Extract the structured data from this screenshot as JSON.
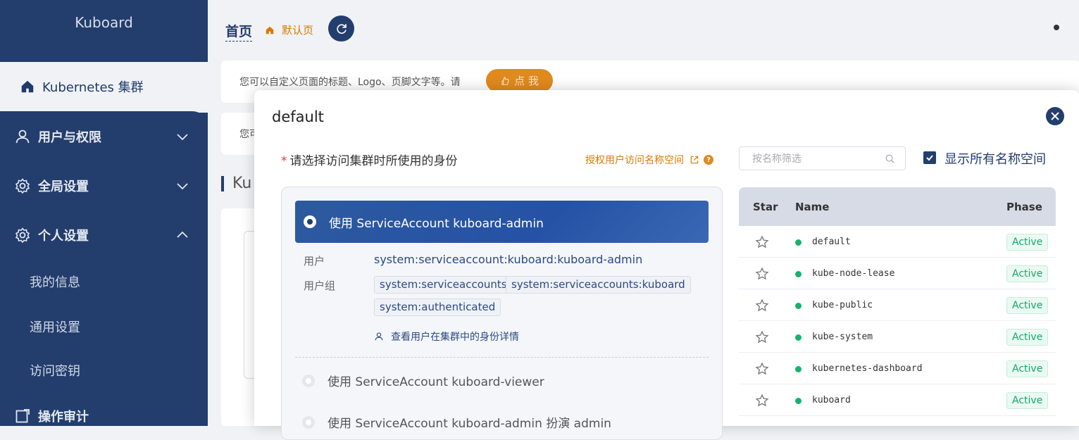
{
  "sidebar": {
    "brand": "Kuboard",
    "active_item": "Kubernetes 集群",
    "items": [
      {
        "label": "用户与权限"
      },
      {
        "label": "全局设置"
      },
      {
        "label": "个人设置"
      }
    ],
    "sub_items": [
      {
        "label": "我的信息"
      },
      {
        "label": "通用设置"
      },
      {
        "label": "访问密钥"
      }
    ],
    "bottom_item": "操作审计"
  },
  "topbar": {
    "title": "首页",
    "crumb": "默认页"
  },
  "background": {
    "notice_text": "您可以自定义页面的标题、Logo、页脚文字等。请",
    "click_me": "点 我",
    "notice2_text": "您可",
    "section_title": "Ku"
  },
  "modal": {
    "title": "default",
    "identity_label": "请选择访问集群时所使用的身份",
    "grant_link": "授权用户访问名称空间",
    "selected_option": "使用 ServiceAccount kuboard-admin",
    "user_label": "用户",
    "user_value": "system:serviceaccount:kuboard:kuboard-admin",
    "group_label": "用户组",
    "groups": [
      "system:serviceaccounts",
      "system:serviceaccounts:kuboard",
      "system:authenticated"
    ],
    "detail_link": "查看用户在集群中的身份详情",
    "other_options": [
      "使用 ServiceAccount kuboard-viewer",
      "使用 ServiceAccount kuboard-admin 扮演 admin"
    ],
    "search_placeholder": "按名称筛选",
    "show_all_label": "显示所有名称空间",
    "table": {
      "headers": {
        "star": "Star",
        "name": "Name",
        "phase": "Phase"
      },
      "rows": [
        {
          "name": "default",
          "phase": "Active"
        },
        {
          "name": "kube-node-lease",
          "phase": "Active"
        },
        {
          "name": "kube-public",
          "phase": "Active"
        },
        {
          "name": "kube-system",
          "phase": "Active"
        },
        {
          "name": "kubernetes-dashboard",
          "phase": "Active"
        },
        {
          "name": "kuboard",
          "phase": "Active"
        }
      ]
    }
  }
}
